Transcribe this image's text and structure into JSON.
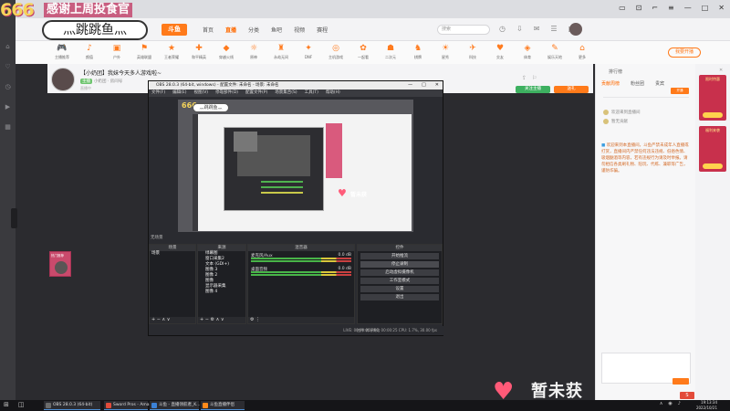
{
  "overlay": {
    "counter": "666",
    "banner": "感谢上周投食官",
    "streamer_name": "灬跳跳鱼灬",
    "bottom_text": "暂未获"
  },
  "browser": {
    "logo": "斗鱼",
    "nav": [
      "首页",
      "直播",
      "分类",
      "鱼吧",
      "视频",
      "赛程"
    ],
    "nav_active": 2,
    "search_placeholder": "搜索",
    "categories": [
      {
        "icon": "🎮",
        "label": "主播推荐"
      },
      {
        "icon": "♪",
        "label": "颜值"
      },
      {
        "icon": "▣",
        "label": "户外"
      },
      {
        "icon": "⚑",
        "label": "英雄联盟"
      },
      {
        "icon": "★",
        "label": "王者荣耀"
      },
      {
        "icon": "✚",
        "label": "和平精英"
      },
      {
        "icon": "◆",
        "label": "穿越火线"
      },
      {
        "icon": "☼",
        "label": "原神"
      },
      {
        "icon": "♜",
        "label": "永劫无间"
      },
      {
        "icon": "✦",
        "label": "DNF"
      },
      {
        "icon": "◎",
        "label": "主机游戏"
      },
      {
        "icon": "✿",
        "label": "一起看"
      },
      {
        "icon": "☗",
        "label": "二次元"
      },
      {
        "icon": "♞",
        "label": "棋牌"
      },
      {
        "icon": "☀",
        "label": "星秀"
      },
      {
        "icon": "✈",
        "label": "科技"
      },
      {
        "icon": "♥",
        "label": "交友"
      },
      {
        "icon": "◈",
        "label": "体育"
      },
      {
        "icon": "✎",
        "label": "娱乐天地"
      },
      {
        "icon": "⌂",
        "label": "更多"
      }
    ],
    "open_stream_button": "我要开播"
  },
  "room": {
    "title": "【小奶团】我妹今天多人游戏啦~",
    "meta_tag": "主播",
    "meta": "小奶团 · 房间号",
    "meta2": "直播中",
    "follow_button": "关注主播",
    "gift_button": "送礼"
  },
  "obs": {
    "title": "OBS 28.0.3 (64-bit, windows) - 配置文件: 未命名 - 场景: 未命名",
    "menu": [
      "文件(F)",
      "编辑(E)",
      "视图(V)",
      "停靠部件(D)",
      "配置文件(P)",
      "场景集合(S)",
      "工具(T)",
      "帮助(H)"
    ],
    "preview_bubble": "灬跳跳鱼灬",
    "preview_counter": "666",
    "preview_text": "暂未获",
    "scene_label": "无场景",
    "docks": {
      "scenes": {
        "title": "场景",
        "items": [
          "场景"
        ]
      },
      "sources": {
        "title": "来源",
        "items": [
          "绿幕图",
          "窗口采集2",
          "文本 (GDI+)",
          "图像 3",
          "图像 2",
          "图像",
          "显示器采集",
          "图像 4"
        ]
      },
      "mixer": {
        "title": "混音器",
        "channels": [
          {
            "name": "麦克风/Aux",
            "db": "0.0 dB"
          },
          {
            "name": "桌面音频",
            "db": "0.0 dB"
          }
        ]
      },
      "controls": {
        "title": "控件",
        "buttons": [
          "开始推流",
          "停止录制",
          "启动虚拟摄像机",
          "工作室模式",
          "设置",
          "退出"
        ],
        "active": 1
      }
    },
    "status": "LIVE: 00:00:00   REC: 00:00:25   CPU: 1.7%, 30.00 fps",
    "status_tabs": "控件  转场特效"
  },
  "mini_tag": "热门推荐",
  "sidebar": {
    "top_label": "排行榜",
    "tabs": [
      "贡献周榜",
      "粉丝团",
      "贵宾"
    ],
    "tab_active": 0,
    "small_button": "开通",
    "chat": [
      {
        "text": "欢迎来到直播间"
      },
      {
        "text": "暂无贡献"
      }
    ],
    "notice": "欢迎来到本直播间，斗鱼严禁未成年人直播或打赏，直播间内严禁任何违法违规、低俗色情、吸烟酗酒等内容，若有违规行为请及时举报。请勿相信各类刷礼物、陪玩、代练、兼职等广告，谨防诈骗。"
  },
  "ads": [
    {
      "text": "限时特惠"
    },
    {
      "text": "福利来袭"
    }
  ],
  "taskbar": {
    "tasks": [
      {
        "label": "OBS 28.0.3 (64-bit)",
        "color": "#6b6b6b"
      },
      {
        "label": "Sword Pros - Ama...",
        "color": "#e04b3a"
      },
      {
        "label": "斗鱼 - 直播领航者_K...",
        "color": "#3b82d8"
      },
      {
        "label": "斗鱼直播伴侣",
        "color": "#ff8a1a"
      }
    ],
    "tray_app": "S",
    "time": "19:13:34",
    "date": "2022/10/21"
  }
}
